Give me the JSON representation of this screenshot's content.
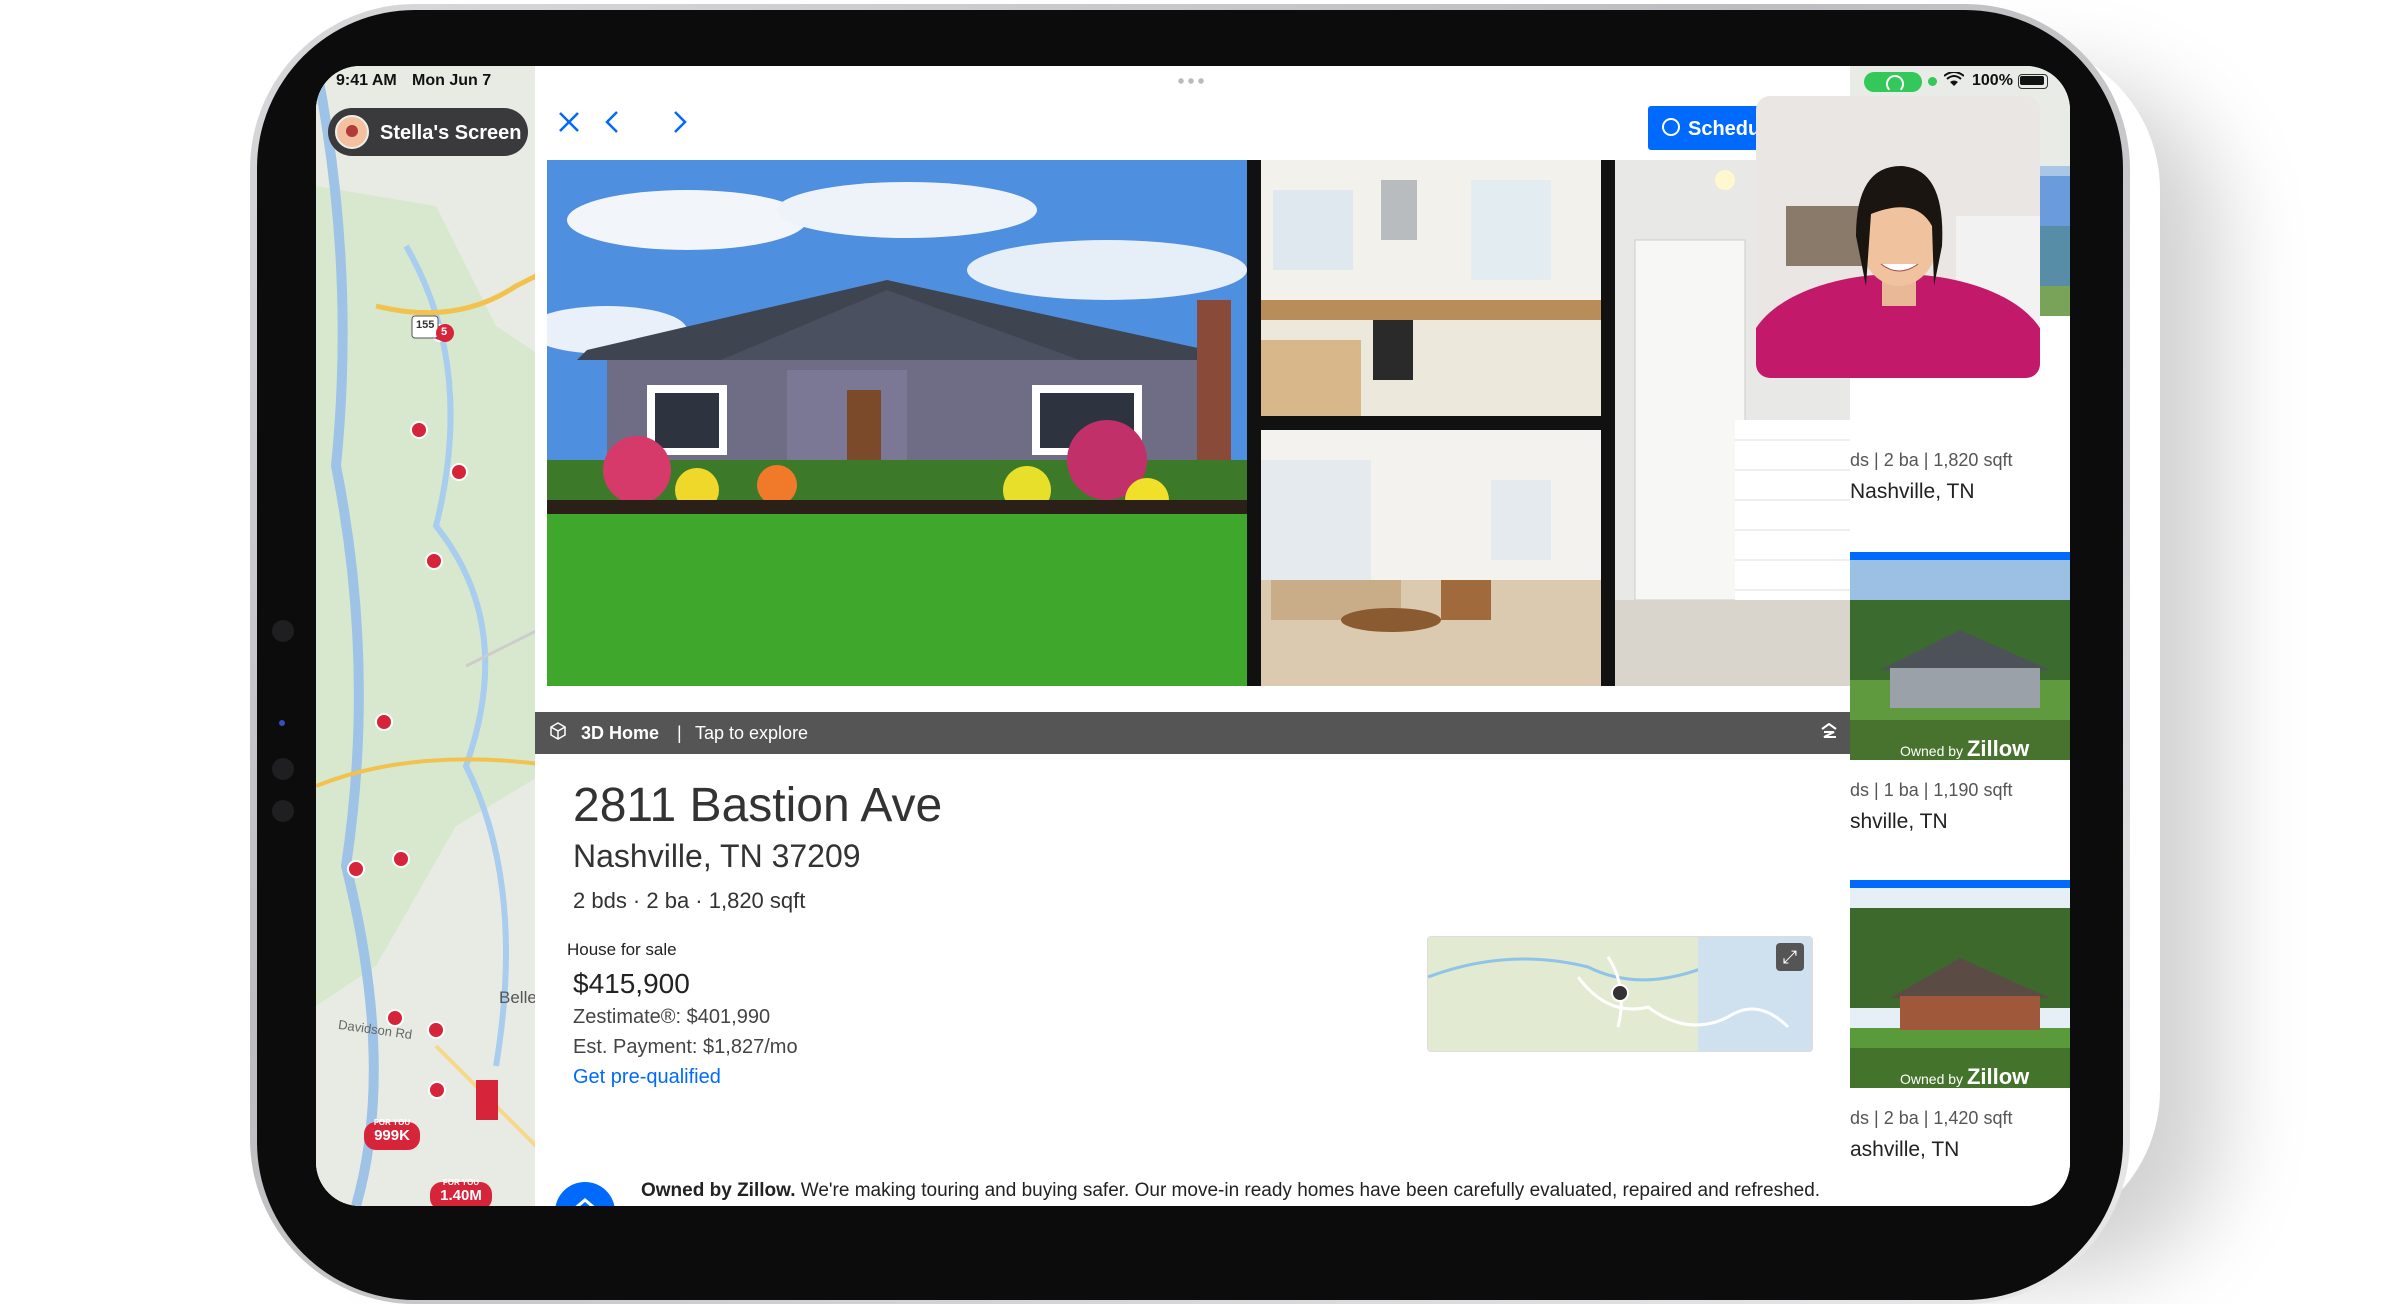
{
  "status": {
    "time": "9:41 AM",
    "date": "Mon Jun 7",
    "battery": "100%"
  },
  "share_pill": {
    "label": "Stella's Screen"
  },
  "toolbar": {
    "schedule_label": "Schedul"
  },
  "gallery": {
    "tour_label": "3D Home",
    "tour_sep": "|",
    "tour_action": "Tap to explore"
  },
  "listing": {
    "address": "2811 Bastion Ave",
    "city": "Nashville, TN 37209",
    "facts": "2 bds · 2 ba · 1,820 sqft",
    "type": "House for sale",
    "price": "$415,900",
    "zestimate": "Zestimate®:  $401,990",
    "payment": "Est. Payment: $1,827/mo",
    "prequal": "Get pre-qualified",
    "owned_bold": "Owned by Zillow.",
    "owned_text": " We're making touring and buying safer. Our move-in ready homes have been carefully evaluated, repaired and refreshed."
  },
  "right_cards": [
    {
      "meta": "ds  |  2 ba  |  1,820 sqft",
      "city": "Nashville, TN",
      "owned_prefix": "",
      "owned_brand": ""
    },
    {
      "meta": "ds  |  1 ba  |  1,190 sqft",
      "city": "shville, TN",
      "owned_prefix": "Owned by",
      "owned_brand": "Zillow"
    },
    {
      "meta": "ds  |  2 ba  |  1,420 sqft",
      "city": "ashville, TN",
      "owned_prefix": "Owned by",
      "owned_brand": "Zillow"
    }
  ],
  "map_labels": {
    "road": "Davidson Rd",
    "area": "Belle",
    "pin1": "FOR YOU",
    "price1": "999K",
    "pin2": "FOR YOU",
    "price2": "1.40M",
    "shield": "155",
    "route": "5"
  },
  "colors": {
    "accent": "#006aff",
    "pin": "#d6243a",
    "shareplay": "#34c759"
  }
}
